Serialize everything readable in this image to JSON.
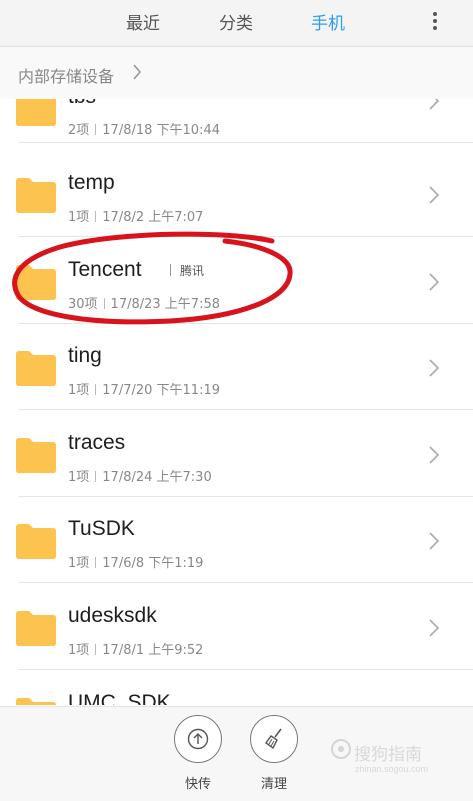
{
  "tabs": [
    {
      "label": "最近",
      "active": false
    },
    {
      "label": "分类",
      "active": false
    },
    {
      "label": "手机",
      "active": true
    }
  ],
  "breadcrumb": {
    "label": "内部存储设备"
  },
  "folders": [
    {
      "name": "tbs",
      "meta_count": "2项",
      "meta_date": "17/8/18 下午10:44"
    },
    {
      "name": "temp",
      "meta_count": "1项",
      "meta_date": "17/8/2 上午7:07"
    },
    {
      "name": "Tencent",
      "tag": "腾讯",
      "meta_count": "30项",
      "meta_date": "17/8/23 上午7:58",
      "highlighted": true
    },
    {
      "name": "ting",
      "meta_count": "1项",
      "meta_date": "17/7/20 下午11:19"
    },
    {
      "name": "traces",
      "meta_count": "1项",
      "meta_date": "17/8/24 上午7:30"
    },
    {
      "name": "TuSDK",
      "meta_count": "1项",
      "meta_date": "17/6/8 下午1:19"
    },
    {
      "name": "udesksdk",
      "meta_count": "1项",
      "meta_date": "17/8/1 上午9:52"
    },
    {
      "name": "UMC_SDK"
    }
  ],
  "bottom_actions": [
    {
      "label": "快传",
      "icon": "upload-circle-icon"
    },
    {
      "label": "清理",
      "icon": "broom-icon"
    }
  ],
  "watermark": {
    "text": "搜狗指南",
    "url_text": "zhinan.sogou.com"
  },
  "colors": {
    "accent": "#2f9cf0",
    "folder": "#fcc34f",
    "annotation": "#d8131c"
  }
}
